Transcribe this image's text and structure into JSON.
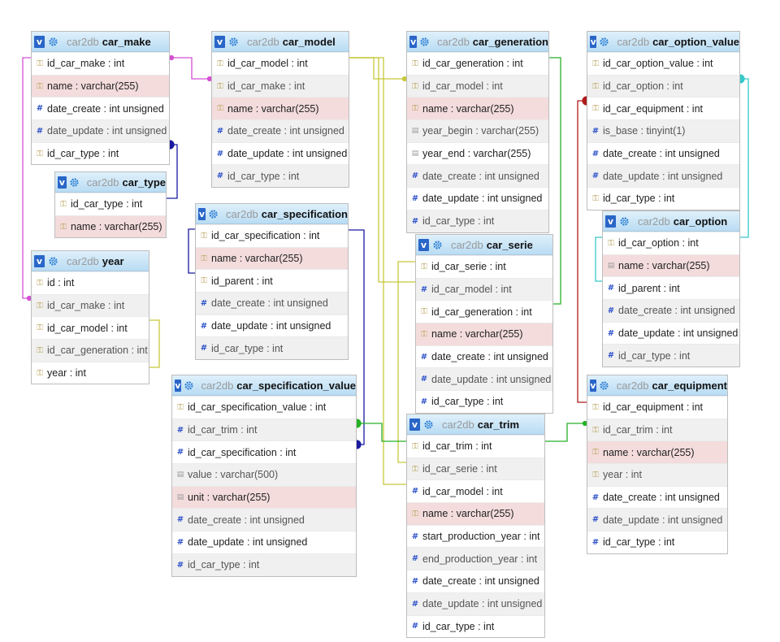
{
  "colors": {
    "header_gradient_top": "#dff0fb",
    "header_gradient_bottom": "#b9dcf3",
    "indexed_row": "#f4dcdc",
    "alt_row": "#f0f0f0",
    "relation_magenta": "#d44fd4",
    "relation_navy": "#1a1aa0",
    "relation_olive": "#c8c83a",
    "relation_green": "#27b027",
    "relation_cyan": "#37c8c8",
    "relation_darkred": "#b01a1a"
  },
  "database": "car2db",
  "header_icons": [
    "v-toggle-icon",
    "gear-icon"
  ],
  "tables": [
    {
      "id": "car_make",
      "name": "car_make",
      "columns": [
        {
          "text": "id_car_make : int",
          "icon": "key-icon",
          "style": "normal"
        },
        {
          "text": "name : varchar(255)",
          "icon": "key-icon",
          "style": "idx"
        },
        {
          "text": "date_create : int unsigned",
          "icon": "number-icon",
          "style": "normal"
        },
        {
          "text": "date_update : int unsigned",
          "icon": "number-icon",
          "style": "alt"
        },
        {
          "text": "id_car_type : int",
          "icon": "key-icon",
          "style": "normal"
        }
      ]
    },
    {
      "id": "car_model",
      "name": "car_model",
      "columns": [
        {
          "text": "id_car_model : int",
          "icon": "key-icon",
          "style": "normal"
        },
        {
          "text": "id_car_make : int",
          "icon": "key-icon",
          "style": "alt"
        },
        {
          "text": "name : varchar(255)",
          "icon": "key-icon",
          "style": "idx"
        },
        {
          "text": "date_create : int unsigned",
          "icon": "number-icon",
          "style": "alt"
        },
        {
          "text": "date_update : int unsigned",
          "icon": "number-icon",
          "style": "normal"
        },
        {
          "text": "id_car_type : int",
          "icon": "number-icon",
          "style": "alt"
        }
      ]
    },
    {
      "id": "car_generation",
      "name": "car_generation",
      "columns": [
        {
          "text": "id_car_generation : int",
          "icon": "key-icon",
          "style": "normal"
        },
        {
          "text": "id_car_model : int",
          "icon": "key-icon",
          "style": "alt"
        },
        {
          "text": "name : varchar(255)",
          "icon": "key-icon",
          "style": "idx"
        },
        {
          "text": "year_begin : varchar(255)",
          "icon": "text-icon",
          "style": "alt"
        },
        {
          "text": "year_end : varchar(255)",
          "icon": "text-icon",
          "style": "normal"
        },
        {
          "text": "date_create : int unsigned",
          "icon": "number-icon",
          "style": "alt"
        },
        {
          "text": "date_update : int unsigned",
          "icon": "number-icon",
          "style": "normal"
        },
        {
          "text": "id_car_type : int",
          "icon": "number-icon",
          "style": "alt"
        }
      ]
    },
    {
      "id": "car_option_value",
      "name": "car_option_value",
      "columns": [
        {
          "text": "id_car_option_value : int",
          "icon": "key-icon",
          "style": "normal"
        },
        {
          "text": "id_car_option : int",
          "icon": "key-icon",
          "style": "alt"
        },
        {
          "text": "id_car_equipment : int",
          "icon": "key-icon",
          "style": "normal"
        },
        {
          "text": "is_base : tinyint(1)",
          "icon": "number-icon",
          "style": "alt"
        },
        {
          "text": "date_create : int unsigned",
          "icon": "number-icon",
          "style": "normal"
        },
        {
          "text": "date_update : int unsigned",
          "icon": "number-icon",
          "style": "alt"
        },
        {
          "text": "id_car_type : int",
          "icon": "key-icon",
          "style": "normal"
        }
      ]
    },
    {
      "id": "car_type",
      "name": "car_type",
      "columns": [
        {
          "text": "id_car_type : int",
          "icon": "key-icon",
          "style": "normal"
        },
        {
          "text": "name : varchar(255)",
          "icon": "key-icon",
          "style": "idx"
        }
      ]
    },
    {
      "id": "car_specification",
      "name": "car_specification",
      "columns": [
        {
          "text": "id_car_specification : int",
          "icon": "key-icon",
          "style": "normal"
        },
        {
          "text": "name : varchar(255)",
          "icon": "key-icon",
          "style": "idx"
        },
        {
          "text": "id_parent : int",
          "icon": "key-icon",
          "style": "normal"
        },
        {
          "text": "date_create : int unsigned",
          "icon": "number-icon",
          "style": "alt"
        },
        {
          "text": "date_update : int unsigned",
          "icon": "number-icon",
          "style": "normal"
        },
        {
          "text": "id_car_type : int",
          "icon": "number-icon",
          "style": "alt"
        }
      ]
    },
    {
      "id": "year",
      "name": "year",
      "columns": [
        {
          "text": "id : int",
          "icon": "key-icon",
          "style": "normal"
        },
        {
          "text": "id_car_make : int",
          "icon": "key-icon",
          "style": "alt"
        },
        {
          "text": "id_car_model : int",
          "icon": "key-icon",
          "style": "normal"
        },
        {
          "text": "id_car_generation : int",
          "icon": "key-icon",
          "style": "alt"
        },
        {
          "text": "year : int",
          "icon": "key-icon",
          "style": "normal"
        }
      ]
    },
    {
      "id": "car_option",
      "name": "car_option",
      "columns": [
        {
          "text": "id_car_option : int",
          "icon": "key-icon",
          "style": "normal"
        },
        {
          "text": "name : varchar(255)",
          "icon": "text-icon",
          "style": "idx"
        },
        {
          "text": "id_parent : int",
          "icon": "number-icon",
          "style": "normal"
        },
        {
          "text": "date_create : int unsigned",
          "icon": "number-icon",
          "style": "alt"
        },
        {
          "text": "date_update : int unsigned",
          "icon": "number-icon",
          "style": "normal"
        },
        {
          "text": "id_car_type : int",
          "icon": "number-icon",
          "style": "alt"
        }
      ]
    },
    {
      "id": "car_serie",
      "name": "car_serie",
      "columns": [
        {
          "text": "id_car_serie : int",
          "icon": "key-icon",
          "style": "normal"
        },
        {
          "text": "id_car_model : int",
          "icon": "number-icon",
          "style": "alt"
        },
        {
          "text": "id_car_generation : int",
          "icon": "key-icon",
          "style": "normal"
        },
        {
          "text": "name : varchar(255)",
          "icon": "key-icon",
          "style": "idx"
        },
        {
          "text": "date_create : int unsigned",
          "icon": "number-icon",
          "style": "normal"
        },
        {
          "text": "date_update : int unsigned",
          "icon": "number-icon",
          "style": "alt"
        },
        {
          "text": "id_car_type : int",
          "icon": "number-icon",
          "style": "normal"
        }
      ]
    },
    {
      "id": "car_specification_value",
      "name": "car_specification_value",
      "columns": [
        {
          "text": "id_car_specification_value : int",
          "icon": "key-icon",
          "style": "normal"
        },
        {
          "text": "id_car_trim : int",
          "icon": "number-icon",
          "style": "alt"
        },
        {
          "text": "id_car_specification : int",
          "icon": "number-icon",
          "style": "normal"
        },
        {
          "text": "value : varchar(500)",
          "icon": "text-icon",
          "style": "alt"
        },
        {
          "text": "unit : varchar(255)",
          "icon": "text-icon",
          "style": "idx"
        },
        {
          "text": "date_create : int unsigned",
          "icon": "number-icon",
          "style": "alt"
        },
        {
          "text": "date_update : int unsigned",
          "icon": "number-icon",
          "style": "normal"
        },
        {
          "text": "id_car_type : int",
          "icon": "number-icon",
          "style": "alt"
        }
      ]
    },
    {
      "id": "car_trim",
      "name": "car_trim",
      "columns": [
        {
          "text": "id_car_trim : int",
          "icon": "key-icon",
          "style": "normal"
        },
        {
          "text": "id_car_serie : int",
          "icon": "key-icon",
          "style": "alt"
        },
        {
          "text": "id_car_model : int",
          "icon": "number-icon",
          "style": "normal"
        },
        {
          "text": "name : varchar(255)",
          "icon": "key-icon",
          "style": "idx"
        },
        {
          "text": "start_production_year : int",
          "icon": "number-icon",
          "style": "normal"
        },
        {
          "text": "end_production_year : int",
          "icon": "number-icon",
          "style": "alt"
        },
        {
          "text": "date_create : int unsigned",
          "icon": "number-icon",
          "style": "normal"
        },
        {
          "text": "date_update : int unsigned",
          "icon": "number-icon",
          "style": "alt"
        },
        {
          "text": "id_car_type : int",
          "icon": "number-icon",
          "style": "normal"
        }
      ]
    },
    {
      "id": "car_equipment",
      "name": "car_equipment",
      "columns": [
        {
          "text": "id_car_equipment : int",
          "icon": "key-icon",
          "style": "normal"
        },
        {
          "text": "id_car_trim : int",
          "icon": "key-icon",
          "style": "alt"
        },
        {
          "text": "name : varchar(255)",
          "icon": "key-icon",
          "style": "idx"
        },
        {
          "text": "year : int",
          "icon": "key-icon",
          "style": "alt"
        },
        {
          "text": "date_create : int unsigned",
          "icon": "number-icon",
          "style": "normal"
        },
        {
          "text": "date_update : int unsigned",
          "icon": "number-icon",
          "style": "alt"
        },
        {
          "text": "id_car_type : int",
          "icon": "number-icon",
          "style": "normal"
        }
      ]
    }
  ]
}
